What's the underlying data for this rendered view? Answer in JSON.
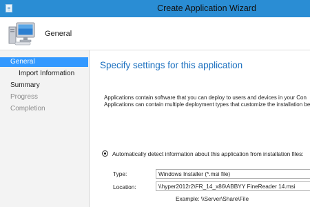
{
  "window": {
    "title": "Create Application Wizard"
  },
  "header": {
    "page_title": "General"
  },
  "sidebar": {
    "steps": [
      {
        "label": "General",
        "state": "active"
      },
      {
        "label": "Import Information",
        "state": "normal"
      },
      {
        "label": "Summary",
        "state": "normal"
      },
      {
        "label": "Progress",
        "state": "disabled"
      },
      {
        "label": "Completion",
        "state": "disabled"
      }
    ]
  },
  "main": {
    "heading": "Specify settings for this application",
    "intro_line1": "Applications contain software that you can deploy to users and devices in your Con",
    "intro_line2": "Applications can contain multiple deployment types that customize the installation be",
    "auto_detect_option": "Automatically detect information about this application from installation files:",
    "type_label": "Type:",
    "type_value": "Windows Installer (*.msi file)",
    "location_label": "Location:",
    "location_value": "\\\\hyper2012r2\\FR_14_x86\\ABBYY FineReader 14.msi",
    "location_example": "Example: \\\\Server\\Share\\File"
  },
  "colors": {
    "titlebar": "#2a8dd4",
    "selected_step": "#3399ff",
    "heading": "#1a6fbf"
  }
}
